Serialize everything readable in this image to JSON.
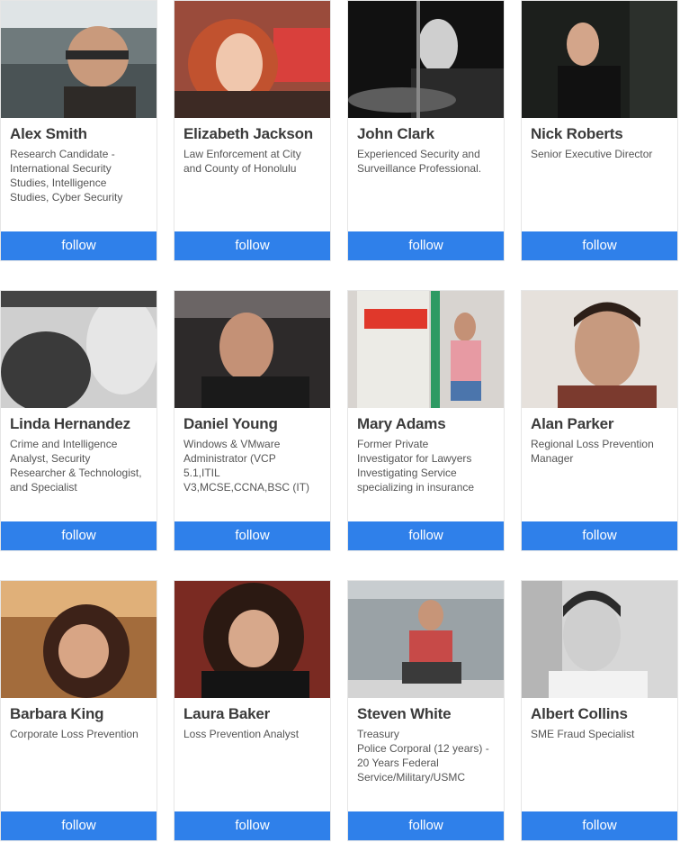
{
  "cards": [
    {
      "name": "Alex Smith",
      "title": "Research Candidate -\nInternational Security\nStudies, Intelligence\nStudies, Cyber Security",
      "follow_label": "follow"
    },
    {
      "name": "Elizabeth Jackson",
      "title": "Law Enforcement at City\nand County of Honolulu",
      "follow_label": "follow"
    },
    {
      "name": "John Clark",
      "title": "Experienced Security and\nSurveillance Professional.",
      "follow_label": "follow"
    },
    {
      "name": "Nick Roberts",
      "title": "Senior Executive Director",
      "follow_label": "follow"
    },
    {
      "name": "Linda Hernandez",
      "title": "Crime and Intelligence\nAnalyst, Security\nResearcher & Technologist,\nand Specialist",
      "follow_label": "follow"
    },
    {
      "name": "Daniel Young",
      "title": "Windows & VMware\nAdministrator (VCP\n5.1,ITIL\nV3,MCSE,CCNA,BSC (IT)",
      "follow_label": "follow"
    },
    {
      "name": "Mary Adams",
      "title": "Former Private\nInvestigator for Lawyers\nInvestigating Service\nspecializing in insurance",
      "follow_label": "follow"
    },
    {
      "name": "Alan Parker",
      "title": "Regional Loss Prevention\nManager",
      "follow_label": "follow"
    },
    {
      "name": "Barbara King",
      "title": "Corporate Loss Prevention",
      "follow_label": "follow"
    },
    {
      "name": "Laura Baker",
      "title": "Loss Prevention Analyst",
      "follow_label": "follow"
    },
    {
      "name": "Steven White",
      "title": "Treasury\nPolice Corporal (12 years) -\n20 Years Federal\nService/Military/USMC",
      "follow_label": "follow"
    },
    {
      "name": "Albert Collins",
      "title": "SME Fraud Specialist",
      "follow_label": "follow"
    }
  ],
  "colors": {
    "accent": "#2f80ea",
    "name_text": "#3b3b3b",
    "title_text": "#555555"
  }
}
